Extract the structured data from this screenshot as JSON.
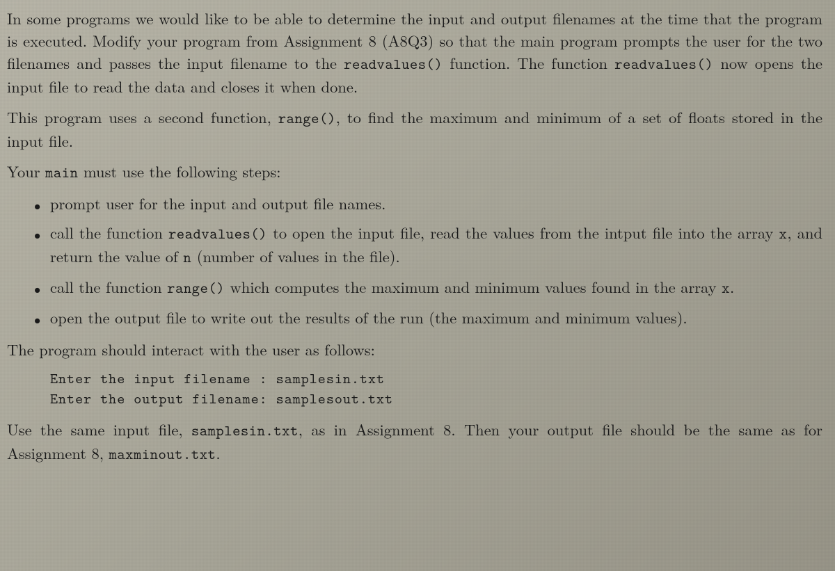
{
  "intro": {
    "p1_a": "In some programs we would like to be able to determine the input and output filenames at the time that the program is executed. Modify your program from Assignment 8 (A8Q3) so that the main program prompts the user for the two filenames and passes the input filename to the ",
    "p1_code1": "readvalues()",
    "p1_b": " function. The function ",
    "p1_code2": "readvalues()",
    "p1_c": " now opens the input file to read the data and closes it when done.",
    "p2_a": "This program uses a second function, ",
    "p2_code1": "range()",
    "p2_b": ", to find the maximum and minimum of a set of floats stored in the input file.",
    "p3_a": "Your ",
    "p3_code1": "main",
    "p3_b": " must use the following steps:"
  },
  "steps": {
    "s1": "prompt user for the input and output file names.",
    "s2_a": "call the function ",
    "s2_code1": "readvalues()",
    "s2_b": " to open the input file, read the values from the intput file into the array ",
    "s2_code2": "x",
    "s2_c": ", and return the value of ",
    "s2_code3": "n",
    "s2_d": " (number of values in the file).",
    "s3_a": "call the function ",
    "s3_code1": "range()",
    "s3_b": " which computes the maximum and minimum values found in the array ",
    "s3_code2": "x",
    "s3_c": ".",
    "s4": "open the output file to write out the results of the run (the maximum and minimum values)."
  },
  "interact": {
    "lead": "The program should interact with the user as follows:",
    "line1": "Enter the input filename : samplesin.txt",
    "line2": "Enter the output filename: samplesout.txt"
  },
  "outro": {
    "a": "Use the same input file, ",
    "code1": "samplesin.txt",
    "b": ", as in Assignment 8. Then your output file should be the same as for Assignment 8, ",
    "code2": "maxminout.txt",
    "c": "."
  }
}
